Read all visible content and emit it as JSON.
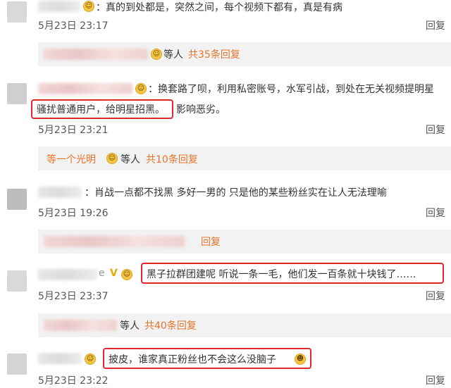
{
  "comments": [
    {
      "text": "：真的到处都是，突然之间，每个视频下都有，真是有病",
      "time": "5月23日 23:17",
      "reply": "回复",
      "sub": {
        "prefix": "",
        "who": "等人",
        "count": "共35条回复"
      }
    },
    {
      "text_line1": "：换套路了呗，利用私密账号，水军引战，到处在无关视频提明星",
      "text_hl": "骚扰普通用户，给明星招黑。",
      "text_tail": "影响恶劣。",
      "time": "5月23日 23:21",
      "reply": "回复",
      "sub": {
        "prefix": "等一个光明",
        "who": "等人",
        "count": "共10条回复"
      }
    },
    {
      "text": "：肖战一点都不找黑 多好一男的 只是他的某些粉丝实在让人无法理喻",
      "time": "5月23日 19:26",
      "reply": "回复",
      "sub": {
        "prefix": "",
        "who": "",
        "count": "回复"
      }
    },
    {
      "name_tail": "e",
      "badge": "V",
      "text_hl": "黑子拉群团建呢 听说一条一毛，他们发一百条就十块钱了……",
      "time": "5月23日 23:37",
      "reply": "回复",
      "sub": {
        "prefix": "",
        "who": "等人",
        "count": "共40条回复"
      }
    },
    {
      "text_hl": "披皮，谁家真正粉丝也不会这么没脑子",
      "time": "5月23日 23:22",
      "reply": "回复"
    }
  ],
  "icons": {
    "emoji": "grin-emoji",
    "laugh": "laughing-emoji"
  },
  "colors": {
    "accent": "#e8742b",
    "highlight_border": "#e0282e"
  }
}
